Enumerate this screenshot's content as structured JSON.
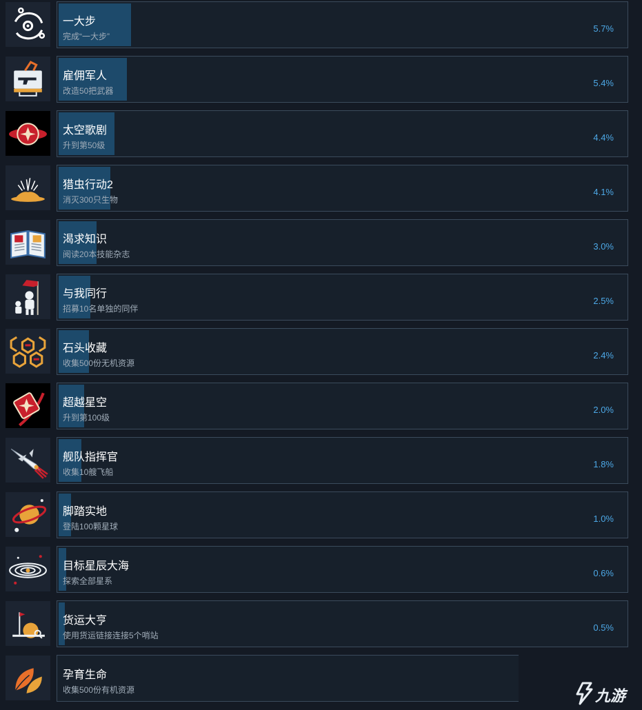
{
  "achievements": [
    {
      "title": "一大步",
      "desc": "完成“一大步”",
      "pct": "5.7%",
      "fill": 0.057,
      "icon": "orbit-eye-icon"
    },
    {
      "title": "雇佣军人",
      "desc": "改造50把武器",
      "pct": "5.4%",
      "fill": 0.054,
      "icon": "weapon-crafting-icon"
    },
    {
      "title": "太空歌剧",
      "desc": "升到第50级",
      "pct": "4.4%",
      "fill": 0.044,
      "icon": "star-emblem-icon"
    },
    {
      "title": "猎虫行动2",
      "desc": "消灭300只生物",
      "pct": "4.1%",
      "fill": 0.041,
      "icon": "creature-mound-icon"
    },
    {
      "title": "渴求知识",
      "desc": "阅读20本技能杂志",
      "pct": "3.0%",
      "fill": 0.03,
      "icon": "open-book-icon"
    },
    {
      "title": "与我同行",
      "desc": "招募10名单独的同伴",
      "pct": "2.5%",
      "fill": 0.025,
      "icon": "astronaut-flag-icon"
    },
    {
      "title": "石头收藏",
      "desc": "收集500份无机资源",
      "pct": "2.4%",
      "fill": 0.024,
      "icon": "hexagon-resources-icon"
    },
    {
      "title": "超越星空",
      "desc": "升到第100级",
      "pct": "2.0%",
      "fill": 0.02,
      "icon": "star-card-icon"
    },
    {
      "title": "舰队指挥官",
      "desc": "收集10艘飞船",
      "pct": "1.8%",
      "fill": 0.018,
      "icon": "spaceship-icon"
    },
    {
      "title": "脚踏实地",
      "desc": "登陆100颗星球",
      "pct": "1.0%",
      "fill": 0.01,
      "icon": "ringed-planet-icon"
    },
    {
      "title": "目标星辰大海",
      "desc": "探索全部星系",
      "pct": "0.6%",
      "fill": 0.006,
      "icon": "galaxy-icon"
    },
    {
      "title": "货运大亨",
      "desc": "使用货运链接连接5个哨站",
      "pct": "0.5%",
      "fill": 0.005,
      "icon": "outpost-flag-icon"
    },
    {
      "title": "孕育生命",
      "desc": "收集500份有机资源",
      "pct": "",
      "fill": 0.0,
      "icon": "leaf-icon"
    }
  ],
  "watermark": {
    "text": "九游",
    "icon": "jiuyou-logo-icon"
  },
  "colors": {
    "background": "#141a24",
    "card": "#17202b",
    "border": "#3b4b5c",
    "bar": "#1d4a6b",
    "percent": "#4da8e6",
    "accent_orange": "#e8a33a",
    "accent_red": "#c8202c"
  }
}
